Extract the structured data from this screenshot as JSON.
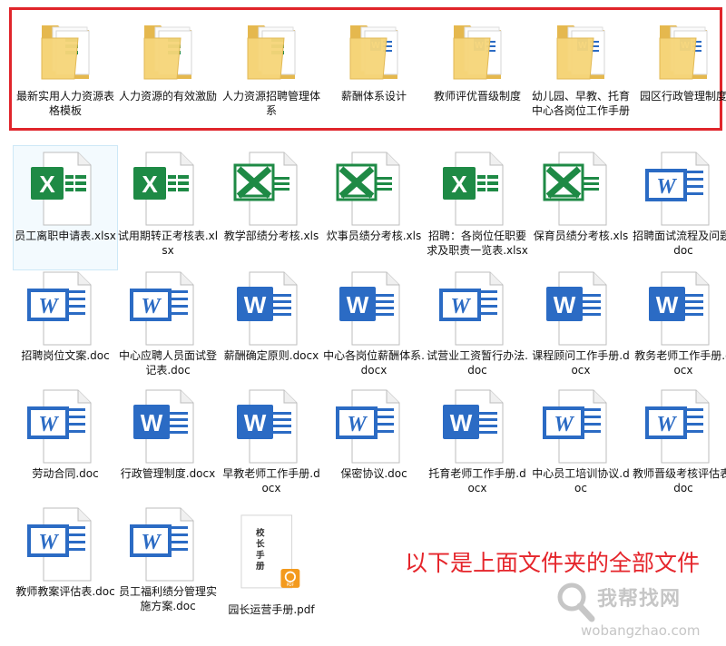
{
  "colors": {
    "highlight_border": "#e0252b",
    "note_text": "#e5252b",
    "excel_green": "#1e8a45",
    "word_blue": "#2b6bc4",
    "folder_yellow": "#f2cf6e"
  },
  "folders": [
    {
      "label": "最新实用人力资源表格模板",
      "badge": "excel"
    },
    {
      "label": "人力资源的有效激励",
      "badge": "excel"
    },
    {
      "label": "人力资源招聘管理体系",
      "badge": "excel"
    },
    {
      "label": "薪酬体系设计",
      "badge": "word"
    },
    {
      "label": "教师评优晋级制度",
      "badge": "word"
    },
    {
      "label": "幼儿园、早教、托育中心各岗位工作手册",
      "badge": "word"
    },
    {
      "label": "园区行政管理制度",
      "badge": "word"
    }
  ],
  "files": [
    {
      "label": "员工离职申请表.xlsx",
      "icon": "excel-x-icon",
      "selected": true
    },
    {
      "label": "试用期转正考核表.xlsx",
      "icon": "excel-x-icon"
    },
    {
      "label": "教学部绩分考核.xls",
      "icon": "excel-legacy-icon"
    },
    {
      "label": "炊事员绩分考核.xls",
      "icon": "excel-legacy-icon"
    },
    {
      "label": "招聘：各岗位任职要求及职责一览表.xlsx",
      "icon": "excel-x-icon"
    },
    {
      "label": "保育员绩分考核.xls",
      "icon": "excel-legacy-icon"
    },
    {
      "label": "招聘面试流程及问题.doc",
      "icon": "word-legacy-icon"
    },
    {
      "label": "招聘岗位文案.doc",
      "icon": "word-legacy-icon"
    },
    {
      "label": "中心应聘人员面试登记表.doc",
      "icon": "word-legacy-icon"
    },
    {
      "label": "薪酬确定原则.docx",
      "icon": "word-docx-icon"
    },
    {
      "label": "中心各岗位薪酬体系.docx",
      "icon": "word-docx-icon"
    },
    {
      "label": "试营业工资暂行办法.doc",
      "icon": "word-legacy-icon"
    },
    {
      "label": "课程顾问工作手册.docx",
      "icon": "word-docx-icon"
    },
    {
      "label": "教务老师工作手册.docx",
      "icon": "word-docx-icon"
    },
    {
      "label": "劳动合同.doc",
      "icon": "word-legacy-icon"
    },
    {
      "label": "行政管理制度.docx",
      "icon": "word-docx-icon"
    },
    {
      "label": "早教老师工作手册.docx",
      "icon": "word-docx-icon"
    },
    {
      "label": "保密协议.doc",
      "icon": "word-legacy-icon"
    },
    {
      "label": "托育老师工作手册.docx",
      "icon": "word-docx-icon"
    },
    {
      "label": "中心员工培训协议.doc",
      "icon": "word-legacy-icon"
    },
    {
      "label": "教师晋级考核评估表.doc",
      "icon": "word-legacy-icon"
    },
    {
      "label": "教师教案评估表.doc",
      "icon": "word-legacy-icon"
    },
    {
      "label": "员工福利绩分管理实施方案.doc",
      "icon": "word-legacy-icon"
    },
    {
      "label": "园长运营手册.pdf",
      "icon": "pdf-thumbnail-icon",
      "thumb_text": "校长手册",
      "badge": "PDF"
    }
  ],
  "note": "以下是上面文件夹的全部文件",
  "watermark": {
    "title": "我帮找网",
    "url": "wobangzhao.com"
  }
}
